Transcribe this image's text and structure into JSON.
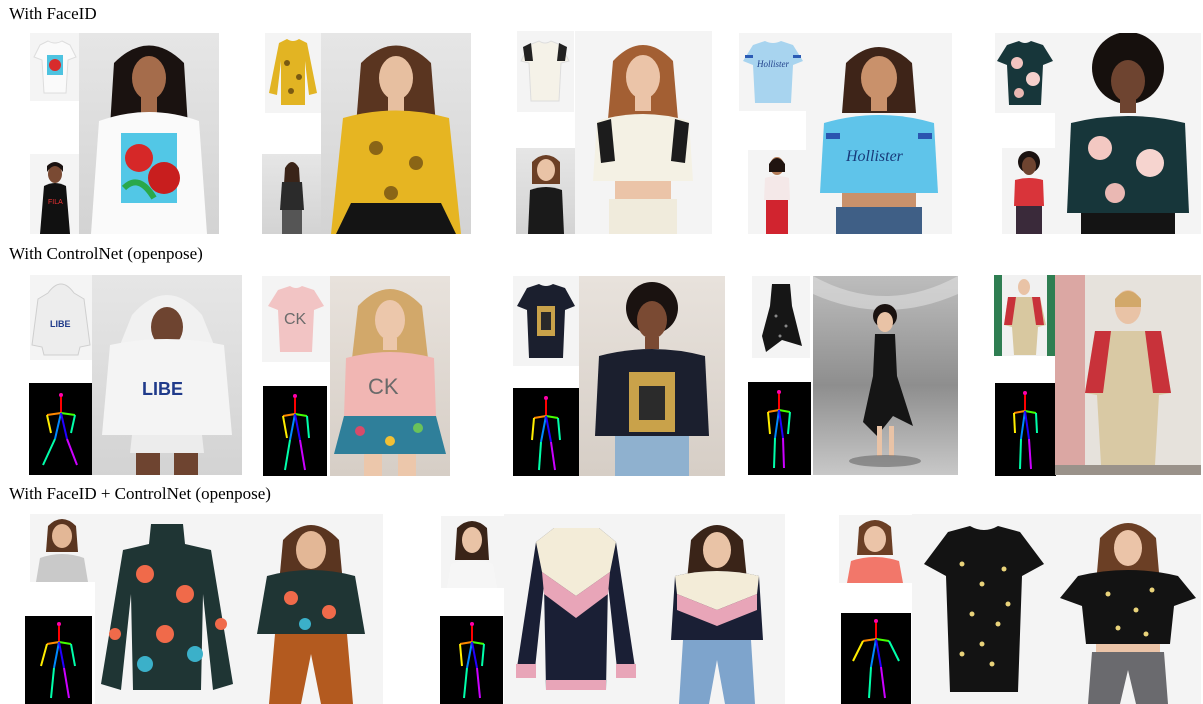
{
  "sections": [
    {
      "title": "With FaceID"
    },
    {
      "title": "With ControlNet (openpose)"
    },
    {
      "title": "With FaceID + ControlNet (openpose)"
    }
  ],
  "colors": {
    "skin_light": "#e9c3a6",
    "skin_mid": "#c9916b",
    "skin_dark": "#6e4430",
    "hair_dark": "#2a1c16",
    "hair_brown": "#6b3f25",
    "hair_blonde": "#d2a86a",
    "pose_limbs": [
      "#ff0000",
      "#ff8800",
      "#ffee00",
      "#44ff00",
      "#00ffaa",
      "#0088ff",
      "#2200ff",
      "#cc00ff"
    ]
  }
}
